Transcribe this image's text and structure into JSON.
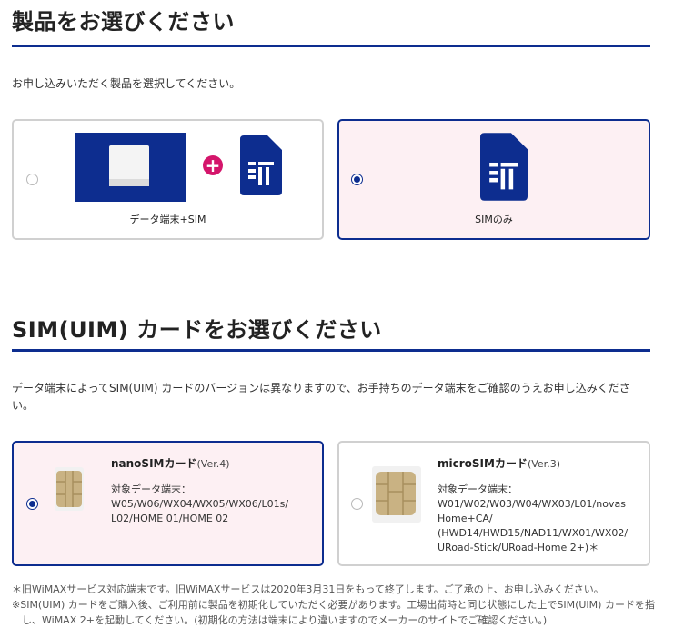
{
  "section1": {
    "title": "製品をお選びください",
    "lead": "お申し込みいただく製品を選択してください。",
    "options": [
      {
        "caption": "データ端末+SIM",
        "selected": false
      },
      {
        "caption": "SIMのみ",
        "selected": true
      }
    ]
  },
  "section2": {
    "title": "SIM(UIM) カードをお選びください",
    "lead_line1": "データ端末によってSIM(UIM) カードのバージョンは異なりますので、お手持ちのデータ端末をご確認のうえお申し込みくださ",
    "lead_line2": "い。",
    "cards": [
      {
        "name": "nanoSIMカード",
        "version": "(Ver.4)",
        "target_label": "対象データ端末：",
        "devices_line1": "W05/W06/WX04/WX05/WX06/L01s/",
        "devices_line2": "L02/HOME 01/HOME 02",
        "devices_line3": "",
        "devices_line4": "",
        "selected": true
      },
      {
        "name": "microSIMカード",
        "version": "(Ver.3)",
        "target_label": "対象データ端末：",
        "devices_line1": "W01/W02/W03/W04/WX03/L01/novas",
        "devices_line2": "Home+CA/",
        "devices_line3": "(HWD14/HWD15/NAD11/WX01/WX02/",
        "devices_line4": "URoad-Stick/URoad-Home 2+)＊",
        "selected": false
      }
    ]
  },
  "notes": {
    "line1": "＊旧WiMAXサービス対応端末です。旧WiMAXサービスは2020年3月31日をもって終了します。ご了承の上、お申し込みください。",
    "line2": "※SIM(UIM) カードをご購入後、ご利用前に製品を初期化していただく必要があります。工場出荷時と同じ状態にした上でSIM(UIM) カードを指",
    "line3": "　し、WiMAX 2+を起動してください。(初期化の方法は端末により違いますのでメーカーのサイトでご確認ください。)"
  },
  "colors": {
    "accent": "#0d2d8f",
    "selected_bg": "#fdf0f3",
    "plus": "#d4156b",
    "border": "#d0d0d0"
  },
  "icons": {
    "router": "router-device-icon",
    "plus": "plus-icon",
    "sim": "sim-card-icon",
    "nano_chip": "nano-sim-chip-icon",
    "micro_chip": "micro-sim-chip-icon"
  }
}
